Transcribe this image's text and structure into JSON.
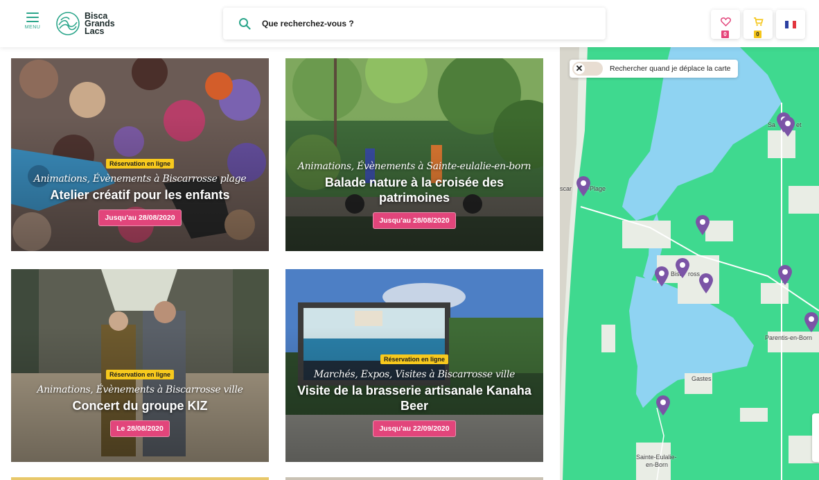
{
  "header": {
    "menu_label": "MENU",
    "logo": {
      "line1": "Bisca",
      "line2": "Grands",
      "line3": "Lacs"
    },
    "search_placeholder": "Que recherchez-vous ?",
    "favorites_count": "0",
    "cart_count": "0",
    "language_flag": "fr-flag-icon"
  },
  "cards": [
    {
      "badge": "Réservation en ligne",
      "category": "Animations, Évènements à Biscarrosse plage",
      "title": "Atelier créatif pour les enfants",
      "date": "Jusqu'au 28/08/2020"
    },
    {
      "badge": "",
      "category": "Animations, Évènements à Sainte-eulalie-en-born",
      "title": "Balade nature à la croisée des patrimoines",
      "date": "Jusqu'au 28/08/2020"
    },
    {
      "badge": "Réservation en ligne",
      "category": "Animations, Évènements à Biscarrosse ville",
      "title": "Concert du groupe KIZ",
      "date": "Le 28/08/2020"
    },
    {
      "badge": "Réservation en ligne",
      "category": "Marchés, Expos, Visites à Biscarrosse ville",
      "title": "Visite de la brasserie artisanale Kanaha Beer",
      "date": "Jusqu'au 22/09/2020"
    }
  ],
  "map": {
    "toggle_label": "Rechercher quand je déplace la carte",
    "places": [
      "Sanguinet",
      "Biscarrosse-Plage",
      "Biscarrosse",
      "Parentis-en-Born",
      "Gastes",
      "Sainte-Eulalie-en-Born"
    ],
    "places_visible": [
      "Sa",
      "et",
      "scar",
      "-Plage",
      "Bisc",
      "ross",
      "Parentis-en-Born",
      "Gastes",
      "Sainte-Eulalie-",
      "en-Born"
    ]
  },
  "colors": {
    "accent_green": "#2aa58a",
    "pink": "#e2457b",
    "yellow": "#f7c91d",
    "map_land": "#3fd98f",
    "map_water": "#8fd3f2",
    "pin_purple": "#7b54a6"
  }
}
